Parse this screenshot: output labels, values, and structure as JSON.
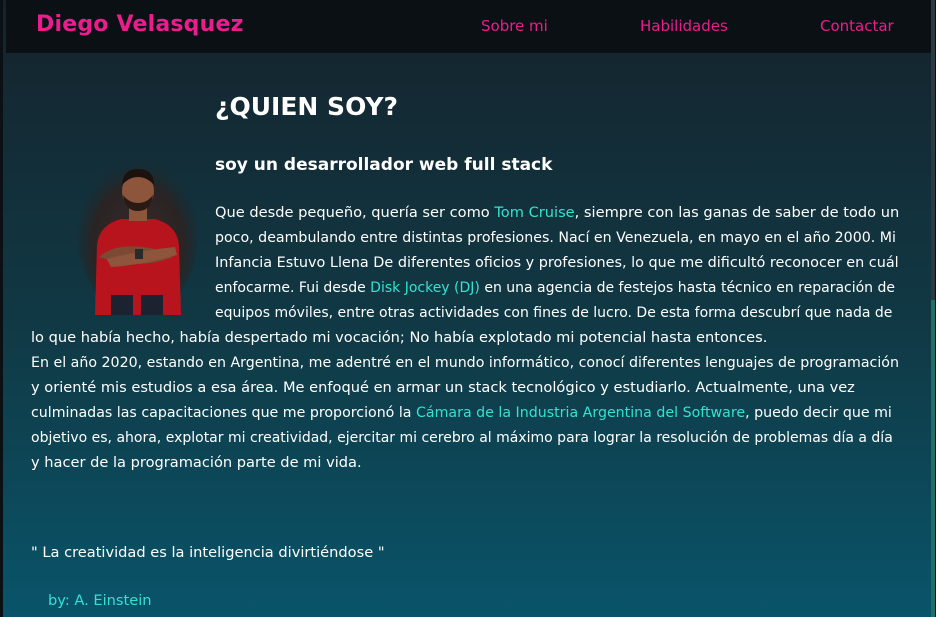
{
  "nav": {
    "brand": "Diego Velasquez",
    "links": [
      "Sobre mi",
      "Habilidades",
      "Contactar"
    ]
  },
  "about": {
    "title": "¿QUIEN SOY?",
    "subtitle": "soy un desarrollador web full stack",
    "portrait_alt": "Diego Velasquez",
    "p1": {
      "l1a": "Que desde pequeño, quería ser como ",
      "l1link": "Tom Cruise",
      "l1b": ", siempre con las ganas de saber de todo un",
      "l2": "poco, deambulando entre distintas profesiones. Nací en Venezuela, en mayo en el año 2000. Mi",
      "l3": "Infancia Estuvo Llena De diferentes oficios y profesiones, lo que me dificultó reconocer en cuál",
      "l4a": "enfocarme. Fui desde ",
      "l4link": "Disk Jockey (DJ)",
      "l4b": " en una agencia de festejos hasta técnico en reparación de",
      "l5": "equipos móviles, entre otras actividades con fines de lucro. De esta forma descubrí que nada de",
      "l6": "lo que había hecho, había despertado mi vocación; No había explotado mi potencial hasta entonces."
    },
    "p2": {
      "l1": "En el año 2020, estando en Argentina, me adentré en el mundo informático, conocí diferentes lenguajes de programación",
      "l2": "y orienté mis estudios a esa área. Me enfoqué en armar un stack tecnológico y estudiarlo. Actualmente, una vez",
      "l3a": "culminadas las capacitaciones que me proporcionó la ",
      "l3link": "Cámara de la Industria Argentina del Software",
      "l3b": ", puedo decir que mi",
      "l4": "objetivo es, ahora, explotar mi creatividad, ejercitar mi cerebro al máximo para lograr la resolución de problemas día a día",
      "l5": "y hacer de la programación parte de mi vida."
    },
    "quote": "\" La creatividad es la inteligencia divirtiéndose \"",
    "author": "by: A. Einstein"
  },
  "colors": {
    "brand": "#ec1c8d",
    "accent": "#35e1cf",
    "text": "#ffffff",
    "nav_bg": "#0b1014"
  }
}
